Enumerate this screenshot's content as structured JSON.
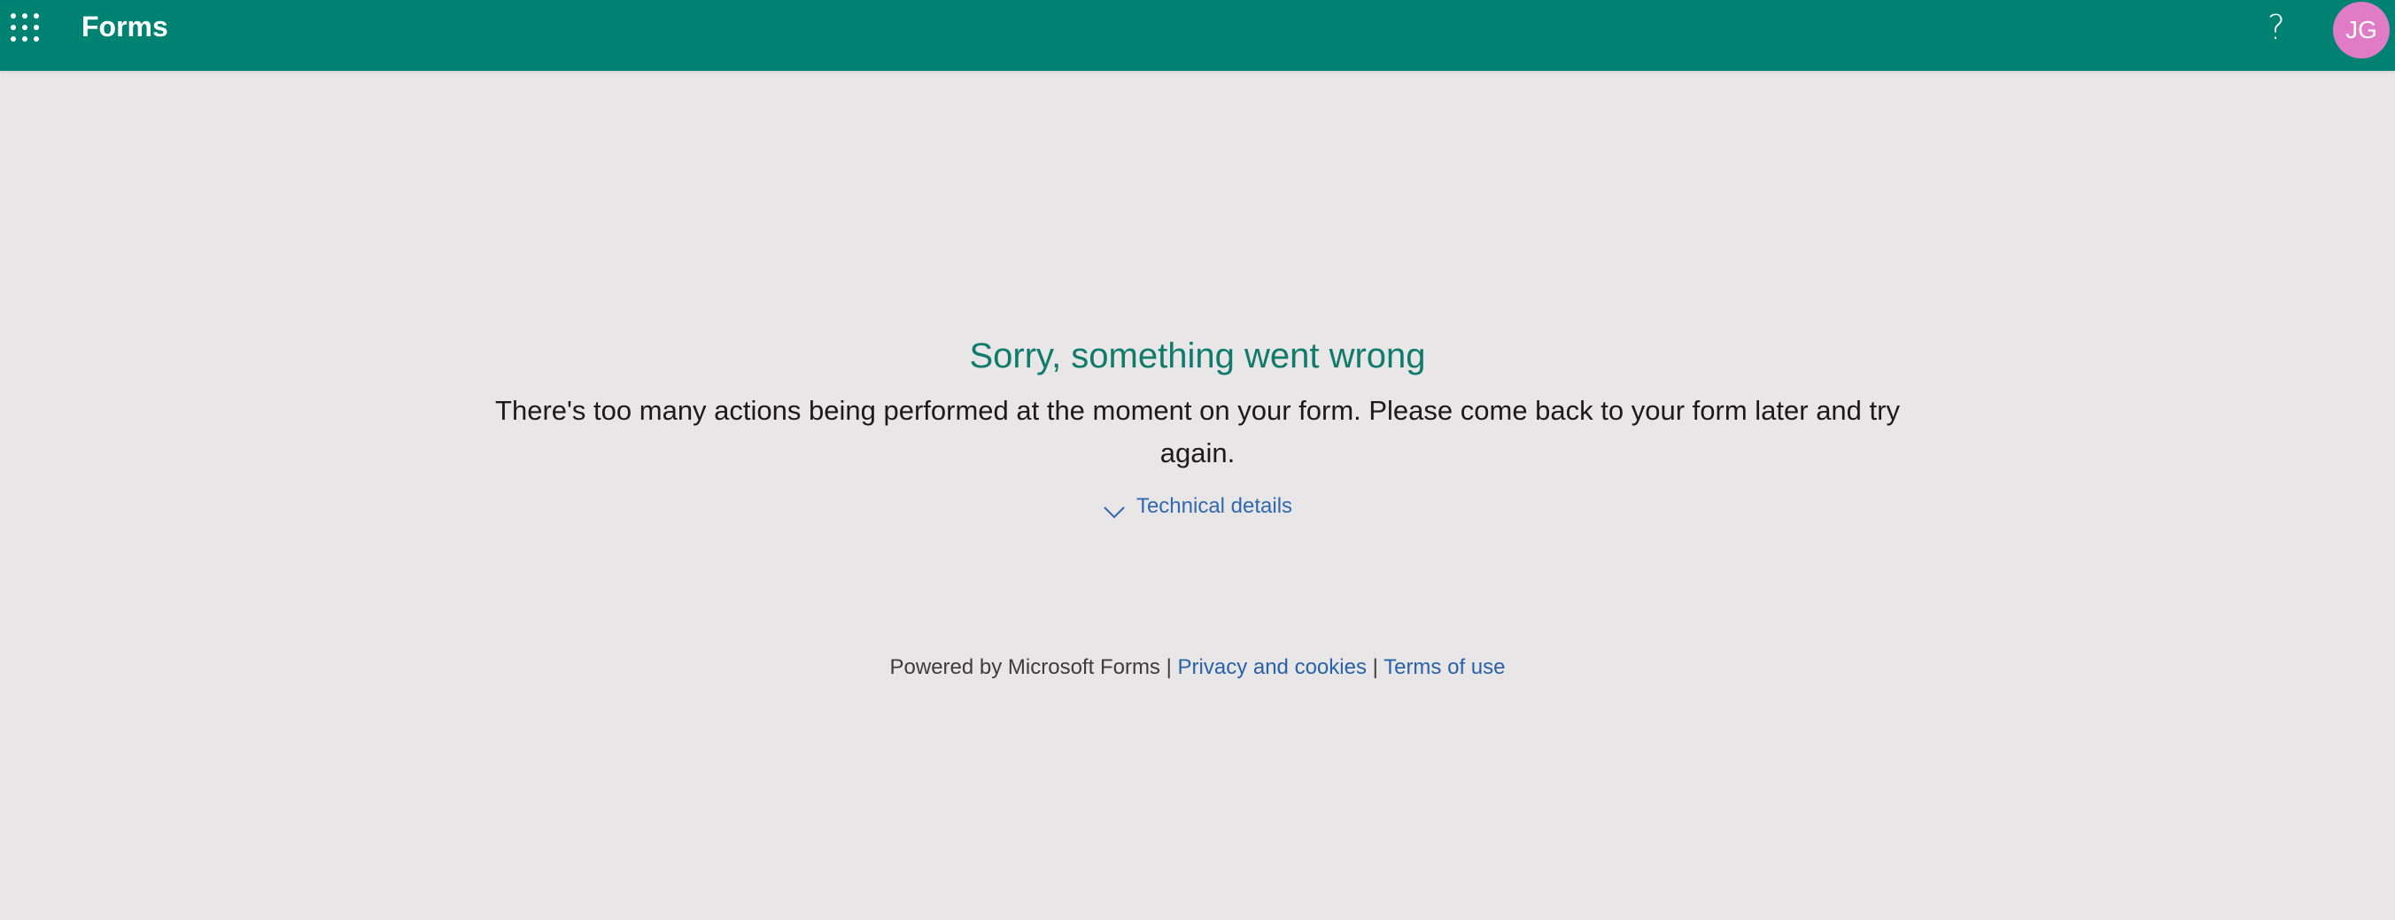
{
  "header": {
    "app_title": "Forms",
    "waffle_icon": "app-launcher-icon",
    "help_label": "?",
    "avatar_initials": "JG",
    "colors": {
      "bar": "#008272",
      "avatar": "#e07cc6"
    }
  },
  "error": {
    "title": "Sorry, something went wrong",
    "message": "There's too many actions being performed at the moment on your form. Please come back to your form later and try again.",
    "details_label": "Technical details",
    "details_icon": "chevron-down-icon",
    "title_color": "#0f7b6c"
  },
  "footer": {
    "powered_by": "Powered by Microsoft Forms",
    "separator": "|",
    "privacy_label": "Privacy and cookies",
    "terms_label": "Terms of use"
  }
}
